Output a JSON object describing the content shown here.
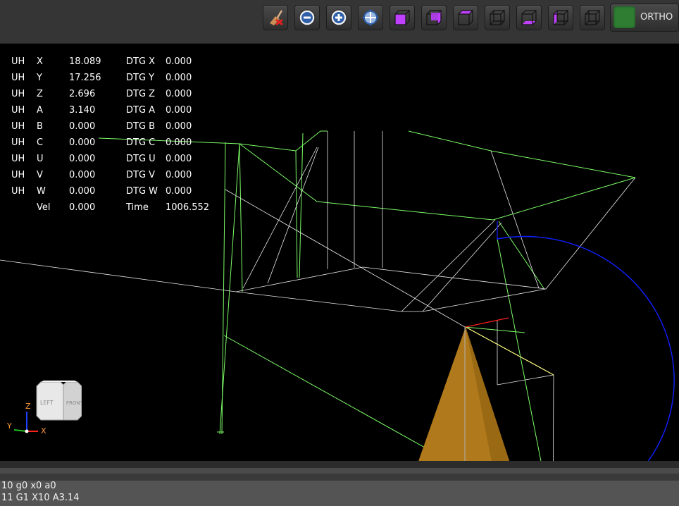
{
  "toolbar": {
    "buttons": [
      {
        "name": "clear-plot-button",
        "icon": "broom-clear-icon"
      },
      {
        "name": "zoom-out-button",
        "icon": "zoom-out-icon"
      },
      {
        "name": "zoom-in-button",
        "icon": "zoom-in-icon"
      },
      {
        "name": "zoom-fit-button",
        "icon": "zoom-fit-icon"
      },
      {
        "name": "view-front-button",
        "icon": "cube-front-icon"
      },
      {
        "name": "view-right-button",
        "icon": "cube-right-icon"
      },
      {
        "name": "view-top-button",
        "icon": "cube-top-icon"
      },
      {
        "name": "view-back-button",
        "icon": "cube-back-icon"
      },
      {
        "name": "view-bottom-button",
        "icon": "cube-bottom-icon"
      },
      {
        "name": "view-left-button",
        "icon": "cube-left-icon"
      },
      {
        "name": "view-iso-button",
        "icon": "cube-iso-icon"
      }
    ],
    "ortho_label": "ORTHO",
    "ortho_color": "#2e7d32",
    "icon_accent": "#c040ff"
  },
  "dro": {
    "rows": [
      {
        "prefix": "UH",
        "axis": "X",
        "value": "18.089",
        "dtg_label": "DTG X",
        "dtg_value": "0.000"
      },
      {
        "prefix": "UH",
        "axis": "Y",
        "value": "17.256",
        "dtg_label": "DTG Y",
        "dtg_value": "0.000"
      },
      {
        "prefix": "UH",
        "axis": "Z",
        "value": "2.696",
        "dtg_label": "DTG Z",
        "dtg_value": "0.000"
      },
      {
        "prefix": "UH",
        "axis": "A",
        "value": "3.140",
        "dtg_label": "DTG A",
        "dtg_value": "0.000"
      },
      {
        "prefix": "UH",
        "axis": "B",
        "value": "0.000",
        "dtg_label": "DTG B",
        "dtg_value": "0.000"
      },
      {
        "prefix": "UH",
        "axis": "C",
        "value": "0.000",
        "dtg_label": "DTG C",
        "dtg_value": "0.000"
      },
      {
        "prefix": "UH",
        "axis": "U",
        "value": "0.000",
        "dtg_label": "DTG U",
        "dtg_value": "0.000"
      },
      {
        "prefix": "UH",
        "axis": "V",
        "value": "0.000",
        "dtg_label": "DTG V",
        "dtg_value": "0.000"
      },
      {
        "prefix": "UH",
        "axis": "W",
        "value": "0.000",
        "dtg_label": "DTG W",
        "dtg_value": "0.000"
      }
    ],
    "vel_label": "Vel",
    "vel_value": "0.000",
    "time_label": "Time",
    "time_value": "1006.552"
  },
  "viewcube": {
    "left_label": "LEFT",
    "front_label": "FRONT"
  },
  "axis_triad": {
    "x_label": "X",
    "y_label": "Y",
    "z_label": "Z"
  },
  "scene_colors": {
    "feed": "#7CFC66",
    "rapid": "#e8e8e8",
    "arc": "#1020ff",
    "tool": "#b07a1c",
    "current": "#ffff80"
  },
  "gcode": {
    "lines": [
      "10 g0 x0 a0",
      "11 G1 X10 A3.14"
    ]
  }
}
